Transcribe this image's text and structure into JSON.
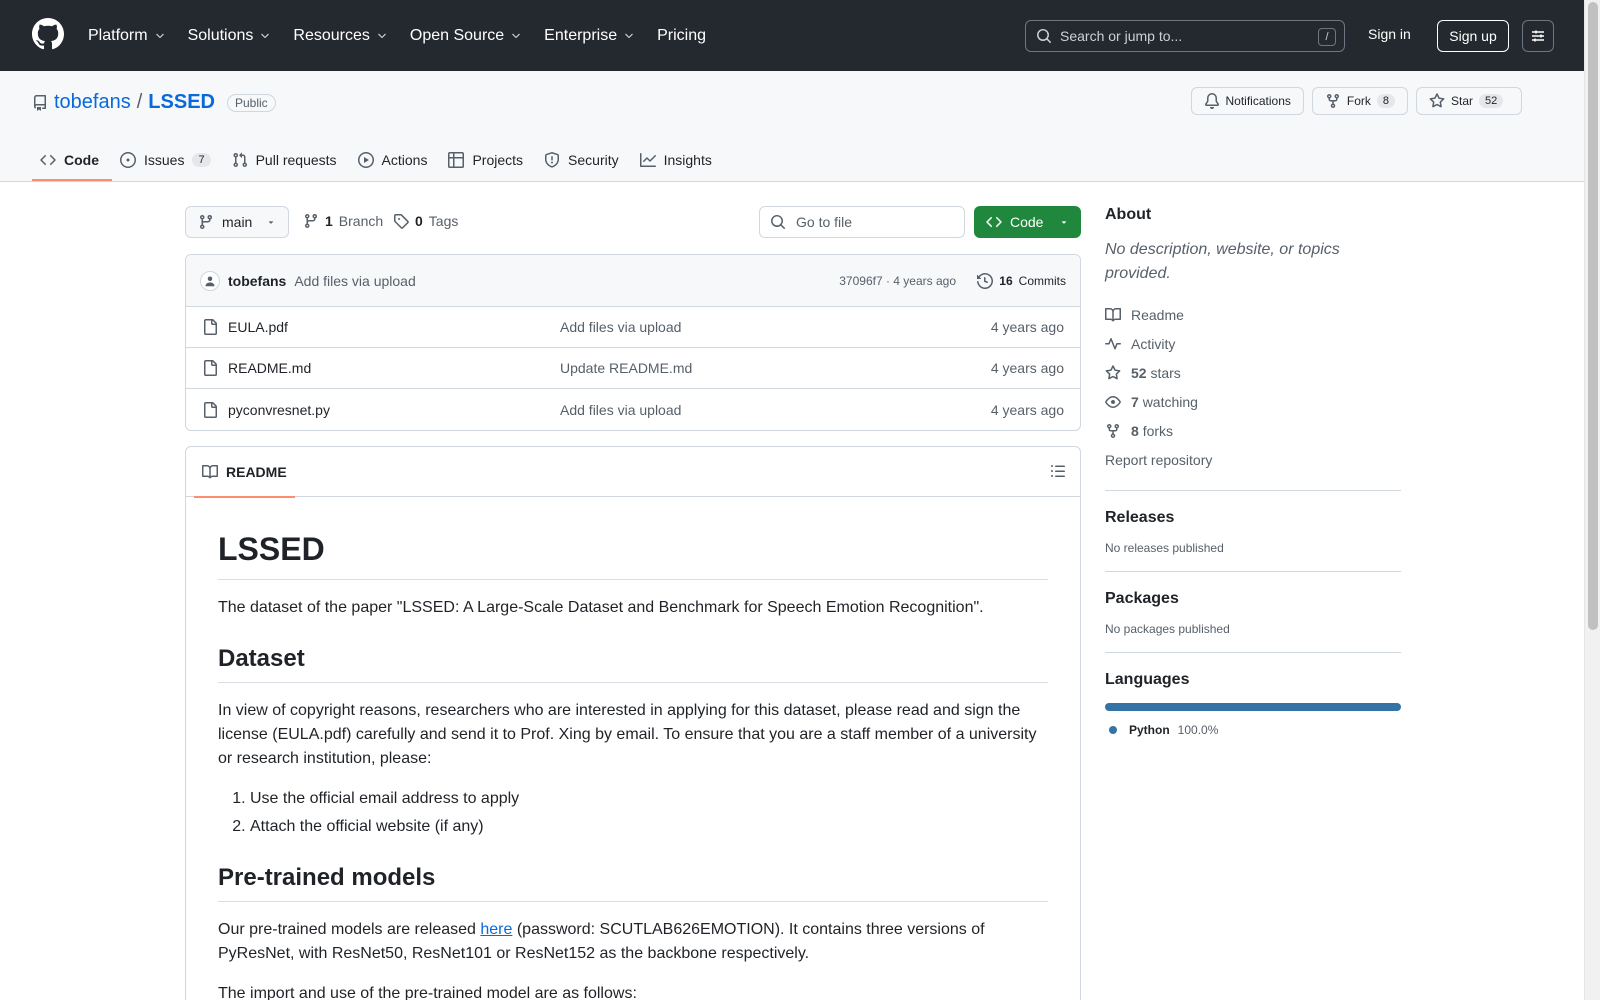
{
  "header": {
    "nav": [
      "Platform",
      "Solutions",
      "Resources",
      "Open Source",
      "Enterprise",
      "Pricing"
    ],
    "search_placeholder": "Search or jump to...",
    "search_shortcut": "/",
    "sign_in": "Sign in",
    "sign_up": "Sign up"
  },
  "repo": {
    "owner": "tobefans",
    "separator": "/",
    "name": "LSSED",
    "visibility": "Public",
    "notifications_label": "Notifications",
    "fork_label": "Fork",
    "fork_count": "8",
    "star_label": "Star",
    "star_count": "52",
    "tabs": [
      {
        "label": "Code",
        "icon": "code-icon"
      },
      {
        "label": "Issues",
        "icon": "issue-icon",
        "count": "7"
      },
      {
        "label": "Pull requests",
        "icon": "pull-request-icon"
      },
      {
        "label": "Actions",
        "icon": "play-icon"
      },
      {
        "label": "Projects",
        "icon": "table-icon"
      },
      {
        "label": "Security",
        "icon": "shield-icon"
      },
      {
        "label": "Insights",
        "icon": "graph-icon"
      }
    ]
  },
  "toolbar": {
    "branch": "main",
    "branch_count": "1",
    "branch_label": "Branch",
    "tag_count": "0",
    "tag_label": "Tags",
    "go_to_file": "Go to file",
    "code_button": "Code"
  },
  "commit": {
    "author": "tobefans",
    "message": "Add files via upload",
    "sha_age": "37096f7 · 4 years ago",
    "commits_count": "16",
    "commits_label": "Commits"
  },
  "files": [
    {
      "name": "EULA.pdf",
      "message": "Add files via upload",
      "age": "4 years ago"
    },
    {
      "name": "README.md",
      "message": "Update README.md",
      "age": "4 years ago"
    },
    {
      "name": "pyconvresnet.py",
      "message": "Add files via upload",
      "age": "4 years ago"
    }
  ],
  "readme": {
    "tab_label": "README",
    "title": "LSSED",
    "intro": "The dataset of the paper \"LSSED: A Large-Scale Dataset and Benchmark for Speech Emotion Recognition\".",
    "h_dataset": "Dataset",
    "dataset_text": "In view of copyright reasons, researchers who are interested in applying for this dataset, please read and sign the license (EULA.pdf) carefully and send it to Prof. Xing by email. To ensure that you are a staff member of a university or research institution, please:",
    "steps": [
      "Use the official email address to apply",
      "Attach the official website (if any)"
    ],
    "h_models": "Pre-trained models",
    "models_text_before": "Our pre-trained models are released ",
    "models_link": "here",
    "models_text_after": " (password: SCUTLAB626EMOTION). It contains three versions of PyResNet, with ResNet50, ResNet101 or ResNet152 as the backbone respectively.",
    "import_text": "The import and use of the pre-trained model are as follows:"
  },
  "sidebar": {
    "about_title": "About",
    "about_desc": "No description, website, or topics provided.",
    "readme_label": "Readme",
    "activity_label": "Activity",
    "stars_count": "52",
    "stars_label": "stars",
    "watching_count": "7",
    "watching_label": "watching",
    "forks_count": "8",
    "forks_label": "forks",
    "report": "Report repository",
    "releases_title": "Releases",
    "releases_empty": "No releases published",
    "packages_title": "Packages",
    "packages_empty": "No packages published",
    "languages_title": "Languages",
    "language": "Python",
    "language_pct": "100.0%",
    "language_color": "#3572a5"
  }
}
